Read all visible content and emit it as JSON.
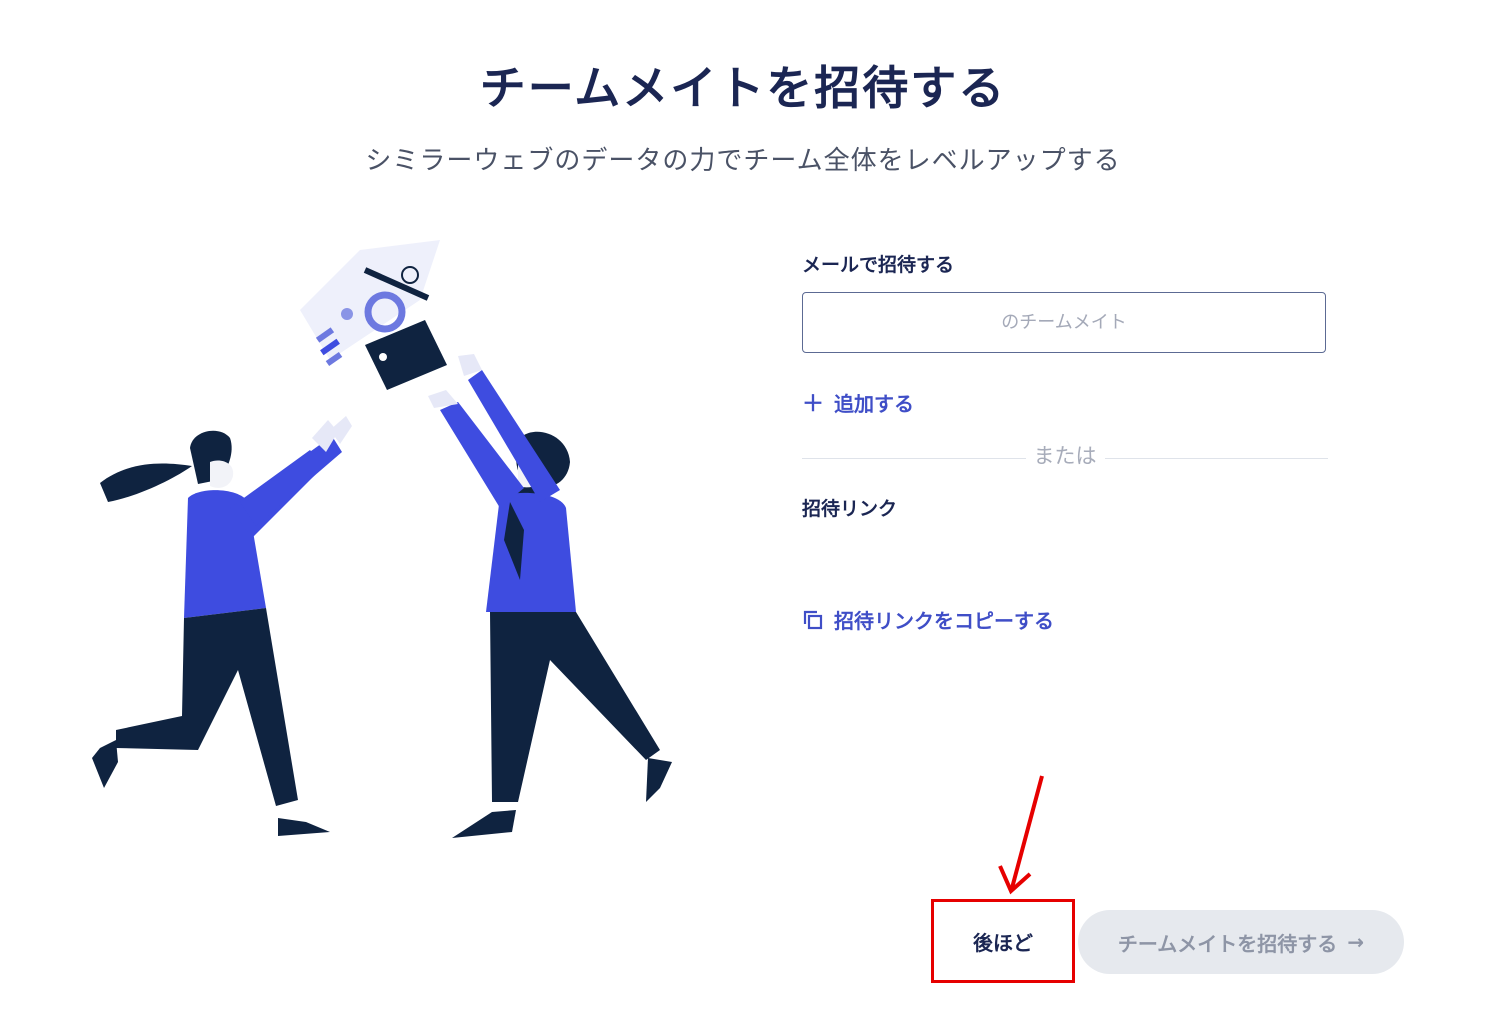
{
  "header": {
    "title": "チームメイトを招待する",
    "subtitle": "シミラーウェブのデータの力でチーム全体をレベルアップする"
  },
  "email_section": {
    "label": "メールで招待する",
    "placeholder": "のチームメイト",
    "add_label": "追加する"
  },
  "divider": {
    "text": "または"
  },
  "link_section": {
    "label": "招待リンク",
    "copy_label": "招待リンクをコピーする"
  },
  "footer": {
    "later_label": "後ほど",
    "invite_label": "チームメイトを招待する"
  },
  "colors": {
    "accent": "#3f4ec7",
    "figure_blue": "#3e4ce0",
    "navy": "#0f2340",
    "annotation": "#e60000",
    "disabled_bg": "#e6e9ee"
  },
  "icons": [
    "plus-icon",
    "copy-icon",
    "arrow-right-icon",
    "annotation-arrow-icon"
  ]
}
